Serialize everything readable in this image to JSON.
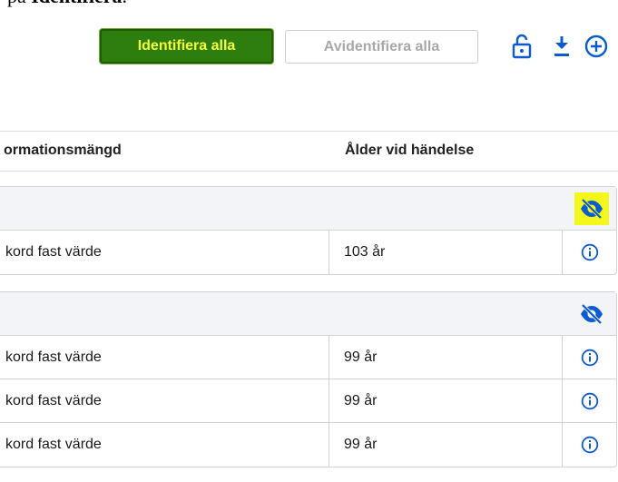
{
  "caption": {
    "prefix": "på ",
    "bold": "Identifiera",
    "suffix": "."
  },
  "toolbar": {
    "identify_all_label": "Identifiera alla",
    "deidentify_all_label": "Avidentifiera alla",
    "icons": [
      "lock-open-icon",
      "download-icon",
      "add-circle-icon"
    ]
  },
  "table": {
    "columns": [
      "ormationsmängd",
      "Ålder vid händelse"
    ],
    "groups": [
      {
        "highlighted": true,
        "rows": [
          {
            "name": "kord fast värde",
            "age": "103 år"
          }
        ]
      },
      {
        "highlighted": false,
        "rows": [
          {
            "name": "kord fast värde",
            "age": "99 år"
          },
          {
            "name": "kord fast värde",
            "age": "99 år"
          },
          {
            "name": "kord fast värde",
            "age": "99 år"
          }
        ]
      }
    ]
  },
  "colors": {
    "accent_blue": "#0a5bd3",
    "identify_bg": "#2e7d0f",
    "identify_text": "#f4ff35",
    "highlight": "#f3f71b"
  }
}
